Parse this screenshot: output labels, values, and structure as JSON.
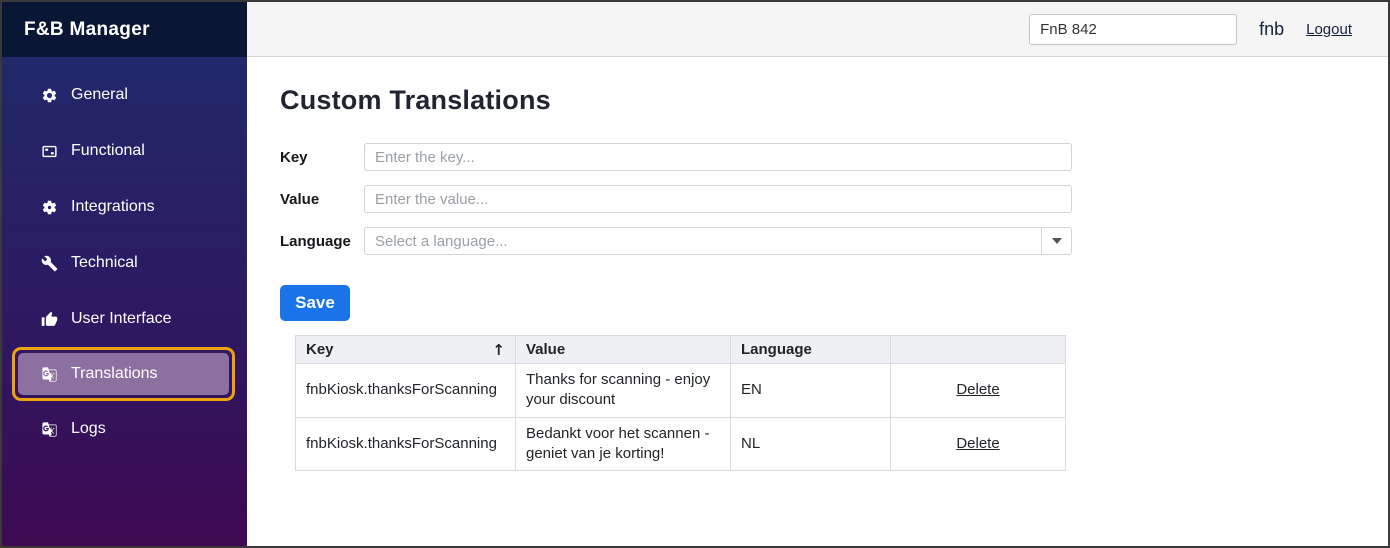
{
  "app": {
    "title": "F&B Manager"
  },
  "topbar": {
    "site_selector": {
      "value": "FnB 842"
    },
    "username": "fnb",
    "logout_label": "Logout"
  },
  "sidebar": {
    "items": [
      {
        "label": "General",
        "icon": "gear",
        "active": false
      },
      {
        "label": "Functional",
        "icon": "window",
        "active": false
      },
      {
        "label": "Integrations",
        "icon": "cog",
        "active": false
      },
      {
        "label": "Technical",
        "icon": "tools",
        "active": false
      },
      {
        "label": "User Interface",
        "icon": "thumb-up",
        "active": false
      },
      {
        "label": "Translations",
        "icon": "translate",
        "active": true
      },
      {
        "label": "Logs",
        "icon": "translate",
        "active": false
      }
    ]
  },
  "main": {
    "title": "Custom Translations",
    "form": {
      "key_label": "Key",
      "key_placeholder": "Enter the key...",
      "value_label": "Value",
      "value_placeholder": "Enter the value...",
      "language_label": "Language",
      "language_placeholder": "Select a language...",
      "save_label": "Save"
    },
    "table": {
      "headers": {
        "key": "Key",
        "value": "Value",
        "language": "Language",
        "actions": ""
      },
      "sort_icon": "↑",
      "rows": [
        {
          "key": "fnbKiosk.thanksForScanning",
          "value": "Thanks for scanning - enjoy your discount",
          "language": "EN",
          "action": "Delete"
        },
        {
          "key": "fnbKiosk.thanksForScanning",
          "value": "Bedankt voor het scannen - geniet van je korting!",
          "language": "NL",
          "action": "Delete"
        }
      ]
    }
  },
  "colors": {
    "accent_blue": "#1a73e8",
    "active_item_border": "#eea20c",
    "active_item_bg": "#8b70a0",
    "sidebar_header_bg": "#0a1636",
    "sidebar_gradient_top": "#1f2b6d",
    "sidebar_gradient_bottom": "#3e0a52",
    "topbar_bg": "#f5f5f6",
    "table_header_bg": "#eef0f3"
  }
}
